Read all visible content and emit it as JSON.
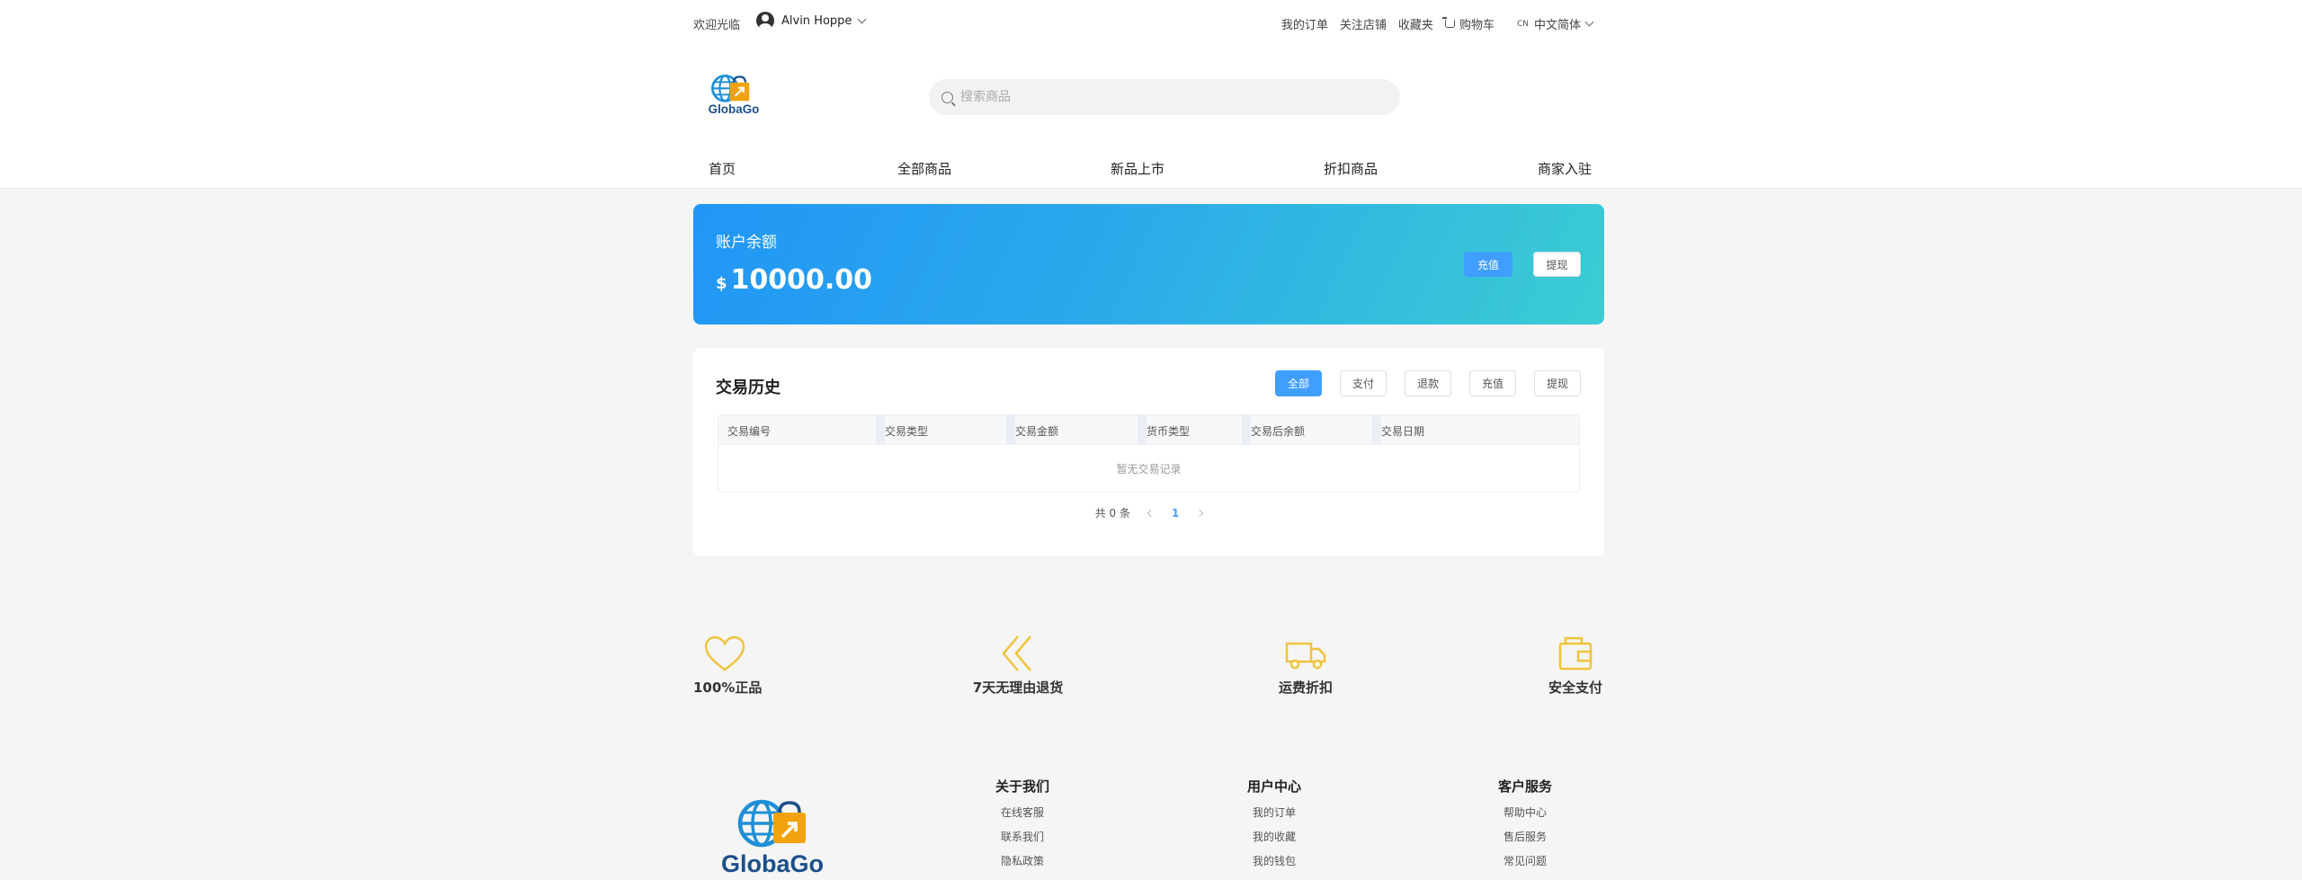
{
  "topbar": {
    "welcome": "欢迎光临",
    "user_name": "Alvin Hoppe",
    "links": [
      "我的订单",
      "关注店铺",
      "收藏夹"
    ],
    "cart_label": "购物车",
    "lang_code": "CN",
    "lang_label": "中文简体"
  },
  "brand": {
    "name": "GlobaGo",
    "colors": {
      "globe": "#1e8fd6",
      "bag": "#f2a20c",
      "text": "#1c4f8b"
    }
  },
  "search": {
    "placeholder": "搜索商品",
    "value": ""
  },
  "nav": {
    "items": [
      "首页",
      "全部商品",
      "新品上市",
      "折扣商品",
      "商家入驻"
    ]
  },
  "balance": {
    "label": "账户余额",
    "currency": "$",
    "amount": "10000.00",
    "recharge_label": "充值",
    "withdraw_label": "提现",
    "gradient": [
      "#2196f6",
      "#3bcdd3"
    ]
  },
  "history": {
    "title": "交易历史",
    "filters": [
      "全部",
      "支付",
      "退款",
      "充值",
      "提现"
    ],
    "active_filter": "全部",
    "columns": [
      "交易编号",
      "交易类型",
      "交易金额",
      "货币类型",
      "交易后余额",
      "交易日期"
    ],
    "rows": [],
    "empty_text": "暂无交易记录",
    "pager": {
      "total_text": "共 0 条",
      "current_page": "1"
    }
  },
  "features": [
    {
      "icon": "heart-icon",
      "label": "100%正品"
    },
    {
      "icon": "double-chevron-left-icon",
      "label": "7天无理由退货"
    },
    {
      "icon": "truck-icon",
      "label": "运费折扣"
    },
    {
      "icon": "wallet-icon",
      "label": "安全支付"
    }
  ],
  "feature_color": "#f0c33c",
  "footer": {
    "columns": [
      {
        "title": "关于我们",
        "links": [
          "在线客服",
          "联系我们",
          "隐私政策"
        ]
      },
      {
        "title": "用户中心",
        "links": [
          "我的订单",
          "我的收藏",
          "我的钱包"
        ]
      },
      {
        "title": "客户服务",
        "links": [
          "帮助中心",
          "售后服务",
          "常见问题"
        ]
      }
    ]
  },
  "accent": "#409eff"
}
